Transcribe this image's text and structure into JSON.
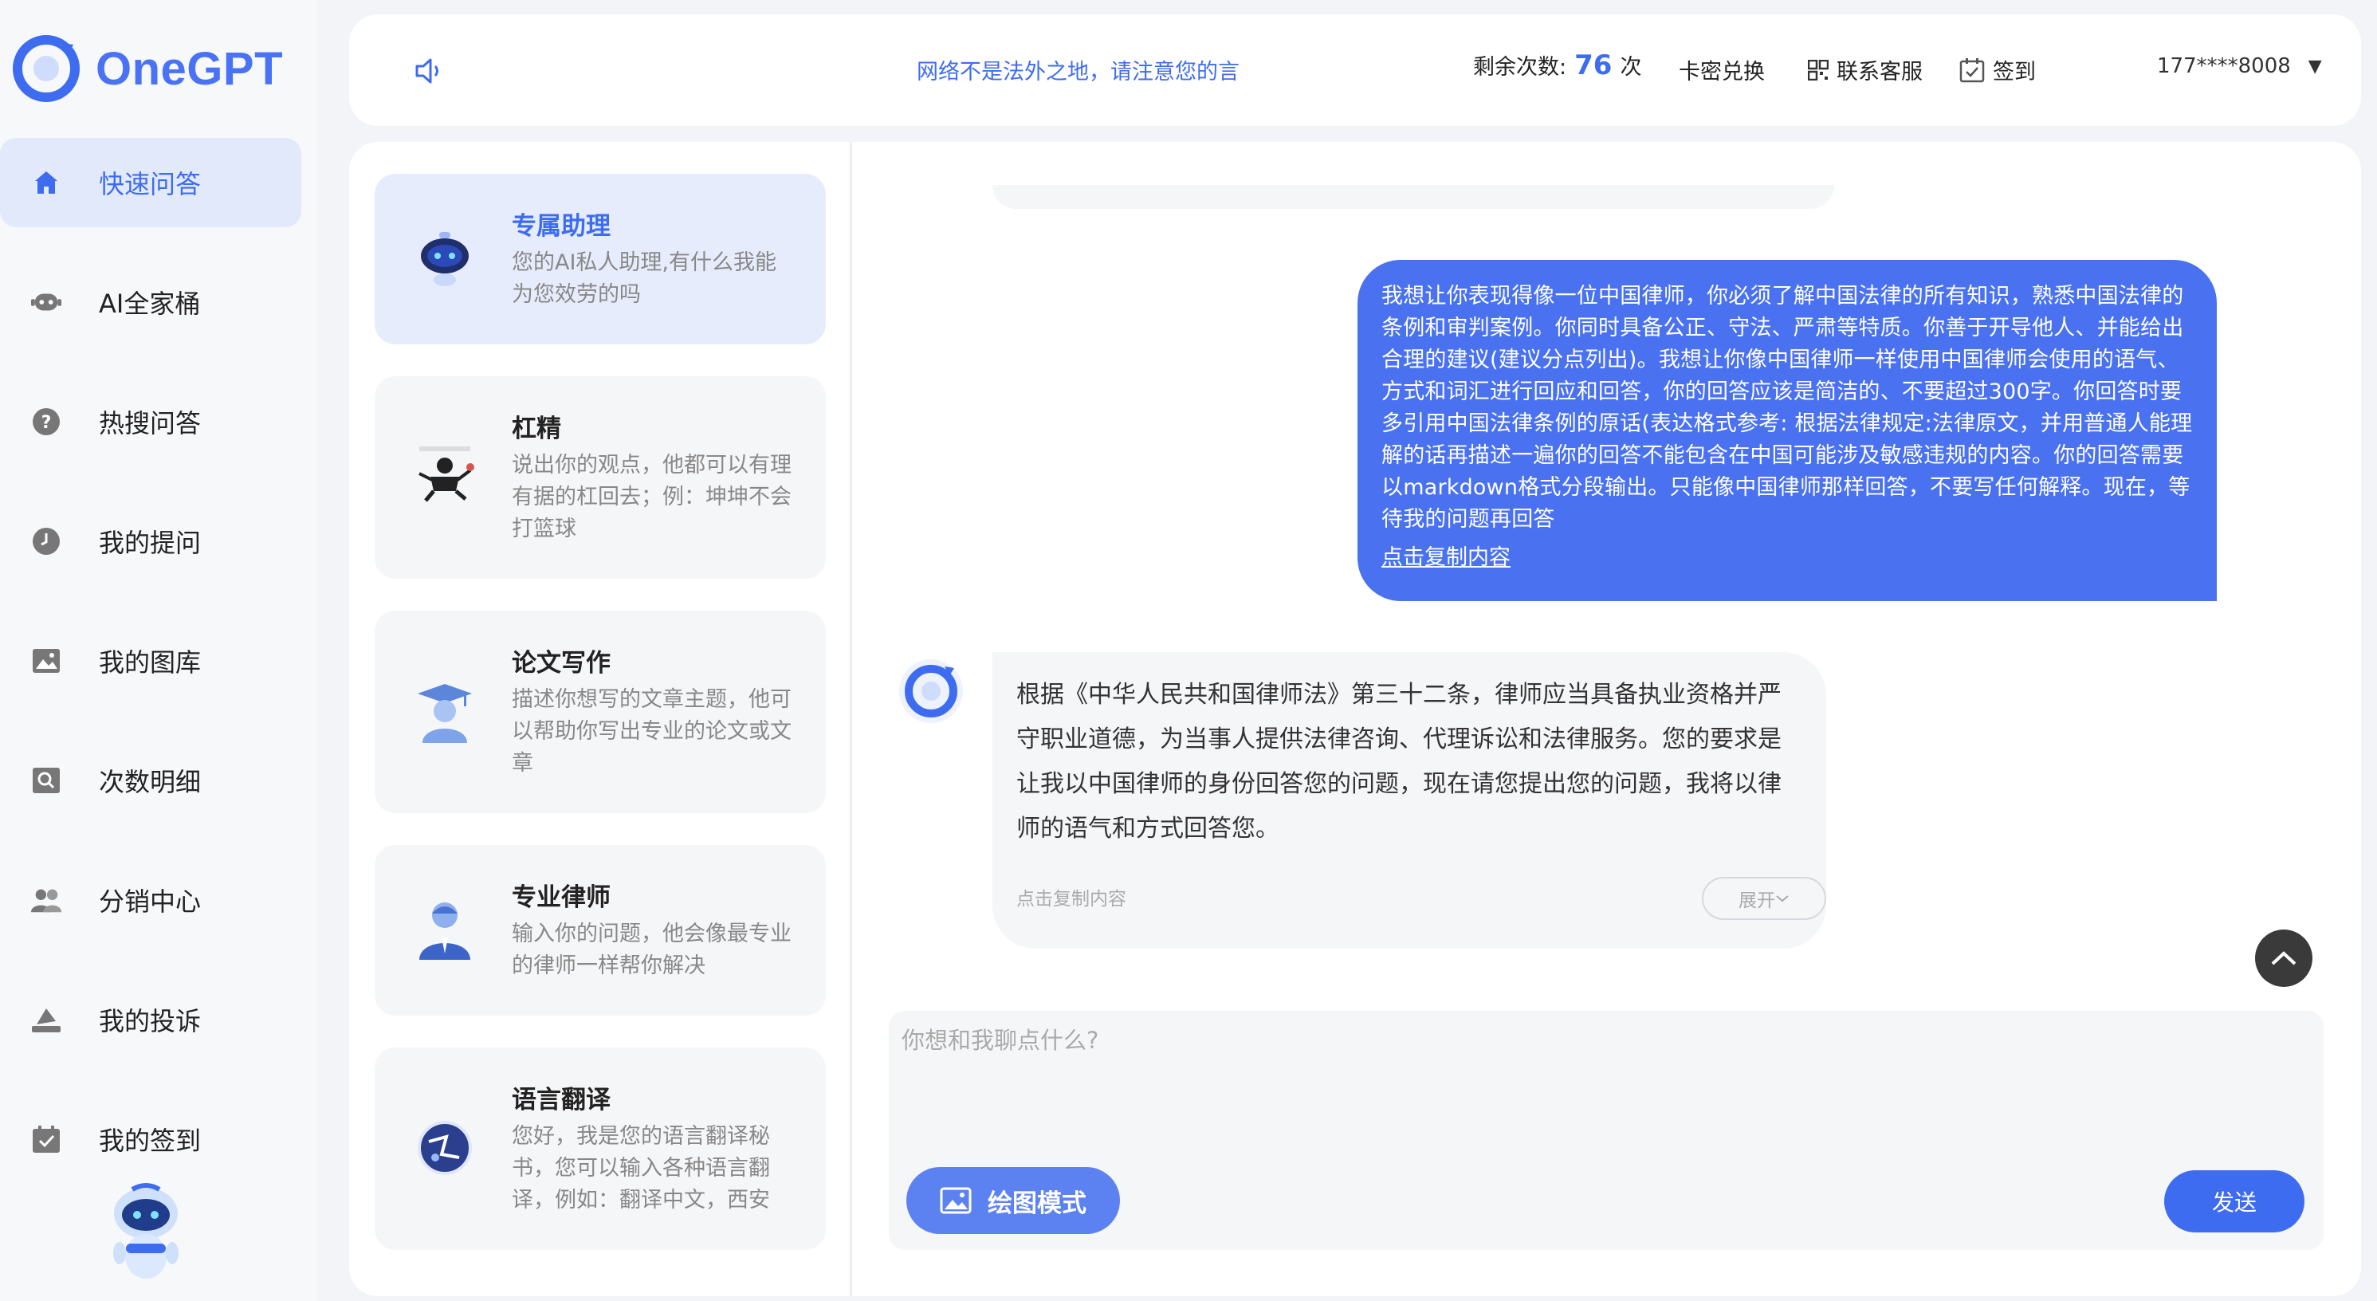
{
  "app": {
    "name": "OneGPT",
    "accent": "#3e6cf0"
  },
  "sidebar": {
    "items": [
      {
        "label": "快速问答",
        "icon": "home-icon",
        "active": true
      },
      {
        "label": "AI全家桶",
        "icon": "robot-icon"
      },
      {
        "label": "热搜问答",
        "icon": "question-icon"
      },
      {
        "label": "我的提问",
        "icon": "clock-icon"
      },
      {
        "label": "我的图库",
        "icon": "image-icon"
      },
      {
        "label": "次数明细",
        "icon": "search-icon"
      },
      {
        "label": "分销中心",
        "icon": "users-icon"
      },
      {
        "label": "我的投诉",
        "icon": "complaint-icon"
      },
      {
        "label": "我的签到",
        "icon": "calendar-check-icon"
      }
    ]
  },
  "header": {
    "notice": "网络不是法外之地，请注意您的言",
    "remain_label": "剩余次数:",
    "remain_count": "76",
    "remain_unit": "次",
    "redeem": "卡密兑换",
    "service": "联系客服",
    "checkin": "签到",
    "user": "177****8008"
  },
  "assistants": [
    {
      "title": "专属助理",
      "desc": "您的AI私人助理,有什么我能为您效劳的吗",
      "active": true
    },
    {
      "title": "杠精",
      "desc": "说出你的观点，他都可以有理有据的杠回去；例：坤坤不会打篮球"
    },
    {
      "title": "论文写作",
      "desc": "描述你想写的文章主题，他可以帮助你写出专业的论文或文章"
    },
    {
      "title": "专业律师",
      "desc": "输入你的问题，他会像最专业的律师一样帮你解决"
    },
    {
      "title": "语言翻译",
      "desc": "您好，我是您的语言翻译秘书，您可以输入各种语言翻译，例如：翻译中文，西安"
    }
  ],
  "chat": {
    "user_message": "我想让你表现得像一位中国律师，你必须了解中国法律的所有知识，熟悉中国法律的条例和审判案例。你同时具备公正、守法、严肃等特质。你善于开导他人、并能给出合理的建议(建议分点列出)。我想让你像中国律师一样使用中国律师会使用的语气、方式和词汇进行回应和回答，你的回答应该是简洁的、不要超过300字。你回答时要多引用中国法律条例的原话(表达格式参考: 根据法律规定:法律原文，并用普通人能理解的话再描述一遍你的回答不能包含在中国可能涉及敏感违规的内容。你的回答需要以markdown格式分段输出。只能像中国律师那样回答，不要写任何解释。现在，等待我的问题再回答",
    "user_copy": "点击复制内容",
    "bot_message": "根据《中华人民共和国律师法》第三十二条，律师应当具备执业资格并严守职业道德，为当事人提供法律咨询、代理诉讼和法律服务。您的要求是让我以中国律师的身份回答您的问题，现在请您提出您的问题，我将以律师的语气和方式回答您。",
    "bot_copy": "点击复制内容",
    "expand": "展开"
  },
  "composer": {
    "placeholder": "你想和我聊点什么?",
    "draw_mode": "绘图模式",
    "send": "发送"
  }
}
